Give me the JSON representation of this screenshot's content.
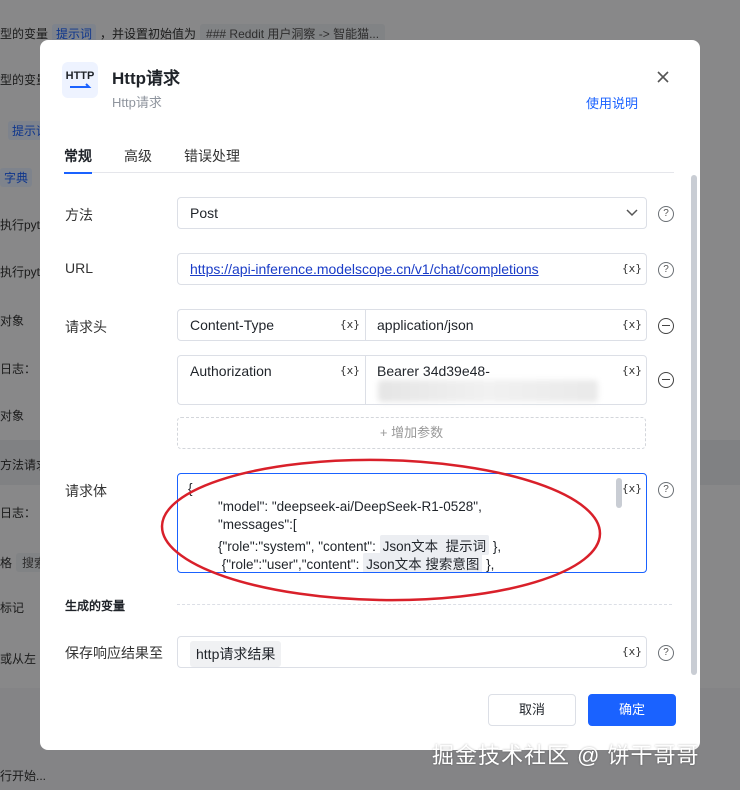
{
  "background": {
    "rows": [
      {
        "prefix": "型的变量",
        "chip": "提示词",
        "suffix": "，并设置初始值为",
        "gray": "### Reddit 用户洞察 -> 智能猫..."
      },
      {
        "prefix": "型的变量"
      },
      {
        "chip": "提示词"
      },
      {
        "chip": "字典"
      },
      {
        "prefix": "执行pyth"
      },
      {
        "prefix": "执行pyth"
      },
      {
        "prefix": "对象"
      },
      {
        "prefix": "日志："
      },
      {
        "prefix": "对象"
      },
      {
        "prefix": "方法请求"
      },
      {
        "prefix": "日志："
      },
      {
        "prefix": "格",
        "gray": "搜索"
      },
      {
        "prefix": "标记"
      },
      {
        "prefix": "或从左"
      },
      {
        "prefix": "行开始..."
      }
    ]
  },
  "modal": {
    "icon_text": "HTTP",
    "title": "Http请求",
    "subtitle": "Http请求",
    "help_link": "使用说明",
    "tabs": [
      {
        "label": "常规",
        "active": true
      },
      {
        "label": "高级",
        "active": false
      },
      {
        "label": "错误处理",
        "active": false
      }
    ],
    "method": {
      "label": "方法",
      "value": "Post"
    },
    "url": {
      "label": "URL",
      "value": "https://api-inference.modelscope.cn/v1/chat/completions"
    },
    "headers": {
      "label": "请求头",
      "rows": [
        {
          "key": "Content-Type",
          "value": "application/json"
        },
        {
          "key": "Authorization",
          "value": "Bearer 34d39e48-"
        }
      ],
      "add_label": "增加参数"
    },
    "body": {
      "label": "请求体",
      "lines": [
        {
          "text": "{"
        },
        {
          "text": "        \"model\": \"deepseek-ai/DeepSeek-R1-0528\","
        },
        {
          "text": "        \"messages\":["
        },
        {
          "text": "        {\"role\":\"system\", \"content\": ",
          "chip": "Json文本_提示词",
          "after": " },"
        },
        {
          "text": "         {\"role\":\"user\",\"content\": ",
          "chip": "Json文本 搜索意图",
          "after": " },"
        }
      ]
    },
    "output": {
      "section_title": "生成的变量",
      "save_label": "保存响应结果至",
      "var_name": "http请求结果"
    },
    "var_symbol": "{x}",
    "cancel_label": "取消",
    "ok_label": "确定"
  },
  "watermark": "掘金技术社区 @ 饼干哥哥",
  "colors": {
    "accent": "#1a62ff",
    "annotation": "#d9202a"
  }
}
